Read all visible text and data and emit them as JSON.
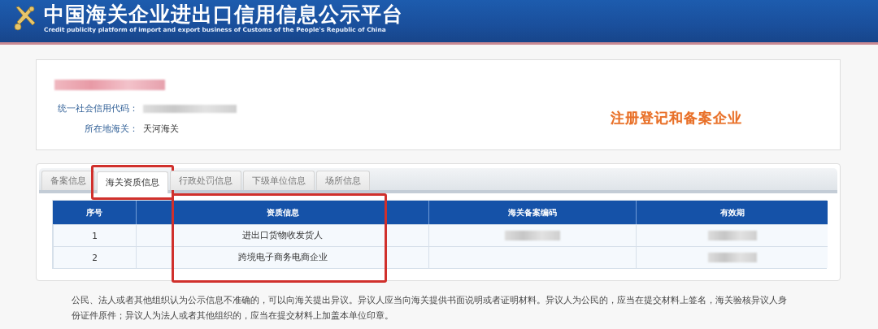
{
  "header": {
    "title": "中国海关企业进出口信用信息公示平台",
    "subtitle": "Credit publicity platform of import and export business of Customs of the People's Republic of China"
  },
  "company": {
    "name": {
      "kind": "redacted"
    },
    "fields": [
      {
        "label": "统一社会信用代码：",
        "value": {
          "kind": "redacted"
        }
      },
      {
        "label": "所在地海关：",
        "value": {
          "kind": "text",
          "text": "天河海关"
        }
      }
    ],
    "badge": "注册登记和备案企业"
  },
  "tabs": [
    {
      "label": "备案信息",
      "selected": false,
      "highlighted": false
    },
    {
      "label": "海关资质信息",
      "selected": true,
      "highlighted": true
    },
    {
      "label": "行政处罚信息",
      "selected": false,
      "highlighted": false
    },
    {
      "label": "下级单位信息",
      "selected": false,
      "highlighted": false
    },
    {
      "label": "场所信息",
      "selected": false,
      "highlighted": false
    }
  ],
  "table": {
    "columns": [
      {
        "label": "序号",
        "highlighted": false
      },
      {
        "label": "资质信息",
        "highlighted": true
      },
      {
        "label": "海关备案编码",
        "highlighted": false
      },
      {
        "label": "有效期",
        "highlighted": false
      }
    ],
    "rows": [
      [
        {
          "kind": "text",
          "text": "1"
        },
        {
          "kind": "text",
          "text": "进出口货物收发货人"
        },
        {
          "kind": "redacted"
        },
        {
          "kind": "redacted"
        }
      ],
      [
        {
          "kind": "text",
          "text": "2"
        },
        {
          "kind": "text",
          "text": "跨境电子商务电商企业"
        },
        {
          "kind": "empty"
        },
        {
          "kind": "redacted"
        }
      ]
    ]
  },
  "notice": "公民、法人或者其他组织认为公示信息不准确的，可以向海关提出异议。异议人应当向海关提供书面说明或者证明材料。异议人为公民的，应当在提交材料上签名，海关验核异议人身份证件原件；异议人为法人或者其他组织的，应当在提交材料上加盖本单位印章。"
}
